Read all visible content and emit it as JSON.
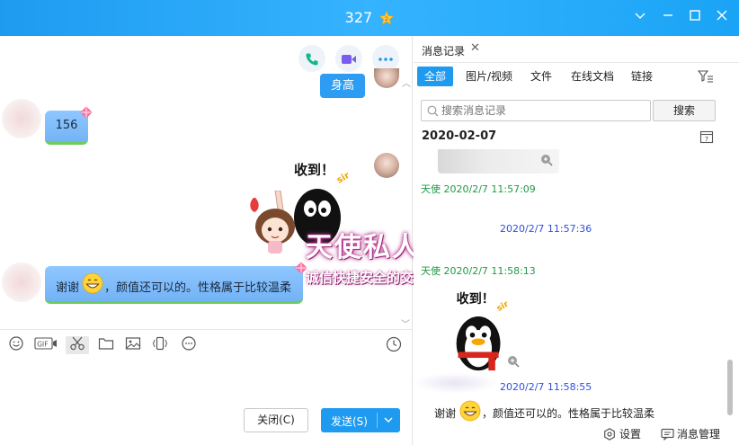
{
  "window": {
    "title": "327",
    "badge_level": "2"
  },
  "chat": {
    "msg_self_1": "身高",
    "msg_peer_1": "156",
    "msg_peer_2_prefix": "谢谢",
    "msg_peer_2_text": "，颜值还可以的。性格属于比较温柔",
    "sticker_text": "收到！",
    "sticker_sir": "sir",
    "watermark_title": "天使私人订制",
    "watermark_sub": "诚信快捷安全的交友平台",
    "close_button": "关闭(C)",
    "send_button": "发送(S)"
  },
  "history": {
    "tab_title": "消息记录",
    "filters": [
      "全部",
      "图片/视频",
      "文件",
      "在线文档",
      "链接"
    ],
    "search_placeholder": "搜索消息记录",
    "search_button": "搜索",
    "date": "2020-02-07",
    "meta_1": "天使 2020/2/7 11:57:09",
    "meta_2": "2020/2/7 11:57:36",
    "meta_3": "天使 2020/2/7 11:58:13",
    "meta_4": "2020/2/7 11:58:55",
    "last_msg_prefix": "谢谢",
    "last_msg_text": "，颜值还可以的。性格属于比较温柔",
    "settings": "设置",
    "manage": "消息管理"
  },
  "colors": {
    "accent": "#1e9af0",
    "meta_green": "#209a43",
    "meta_blue": "#2f4fe0"
  }
}
